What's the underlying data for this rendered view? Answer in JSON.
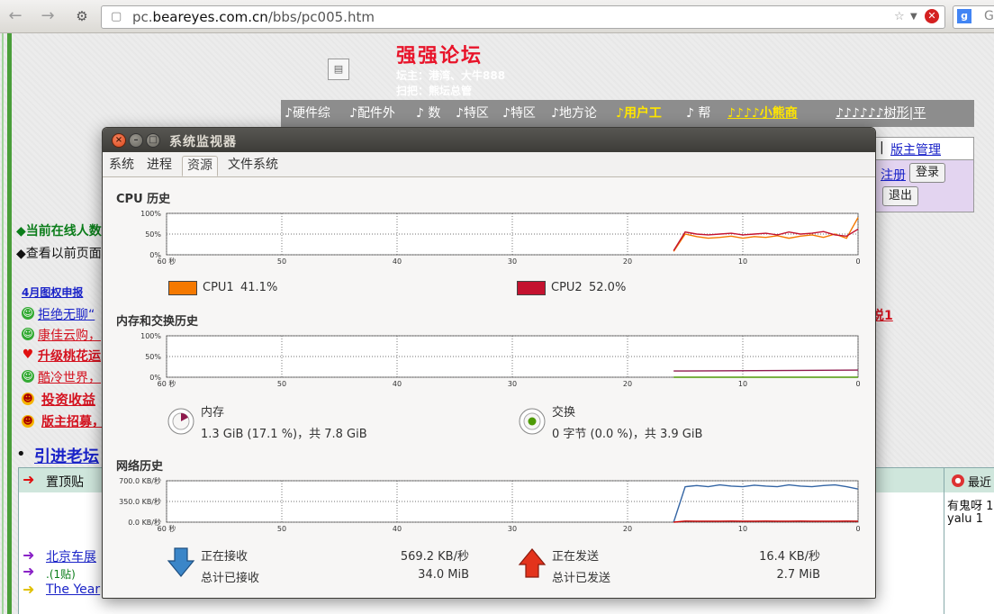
{
  "browser": {
    "url_prefix": "pc.",
    "url_domain": "beareyes.com.cn",
    "url_path": "/bbs/pc005.htm",
    "search_placeholder": "G"
  },
  "forum": {
    "title": "强强论坛",
    "owners": "坛主：港湾、大牛888",
    "sweeper": "扫把：熊坛总管",
    "nav": [
      "硬件综",
      "配件外",
      "数",
      "特区",
      "特区",
      "地方论",
      "用户工",
      "帮",
      "小熊商",
      "树形|平"
    ],
    "admin_link": "版主管理",
    "register_link": "注册",
    "login_button": "登录",
    "logout_button": "退出",
    "online_label": "◆当前在线人数",
    "history_label": "◆查看以前页面",
    "links": [
      {
        "text": "4月图权申报",
        "icon": ""
      },
      {
        "text": "拒绝无聊“",
        "icon": "smile"
      },
      {
        "text": "康佳云购，",
        "icon": "smile"
      },
      {
        "text": "升级桃花运",
        "icon": "heart"
      },
      {
        "text": "酷冷世界，",
        "icon": "smile"
      },
      {
        "text": "投资收益",
        "icon": "grin"
      },
      {
        "text": "版主招募，",
        "icon": "grin"
      }
    ],
    "red_link_right": "说1",
    "intro_title": "引进老坛",
    "pinned_label": "置顶贴",
    "recent_label": "最近",
    "recent_items": [
      "有鬼呀 1",
      "yalu 1"
    ],
    "post_items": [
      "北京车展",
      ".(1贴)",
      "The Year"
    ]
  },
  "window": {
    "title": "系统监视器",
    "tabs": [
      "系统",
      "进程",
      "资源",
      "文件系统"
    ],
    "active_tab": "资源"
  },
  "cpu": {
    "title": "CPU 历史",
    "y_ticks": [
      "100%",
      "50%",
      "0%"
    ],
    "x_ticks": [
      "60 秒",
      "50",
      "40",
      "30",
      "20",
      "10",
      "0"
    ],
    "cpu1_label": "CPU1",
    "cpu1_value": "41.1%",
    "cpu1_color": "#f57900",
    "cpu2_label": "CPU2",
    "cpu2_value": "52.0%",
    "cpu2_color": "#c4122f"
  },
  "memory": {
    "title": "内存和交换历史",
    "y_ticks": [
      "100%",
      "50%",
      "0%"
    ],
    "x_ticks": [
      "60 秒",
      "50",
      "40",
      "30",
      "20",
      "10",
      "0"
    ],
    "mem_label": "内存",
    "mem_value": "1.3 GiB (17.1 %)，共 7.8 GiB",
    "mem_color": "#8e1a4d",
    "swap_label": "交换",
    "swap_value": "0 字节 (0.0 %)，共 3.9 GiB",
    "swap_color": "#4e9a06"
  },
  "network": {
    "title": "网络历史",
    "y_ticks": [
      "700.0 KB/秒",
      "350.0 KB/秒",
      "0.0 KB/秒"
    ],
    "x_ticks": [
      "60 秒",
      "50",
      "40",
      "30",
      "20",
      "10",
      "0"
    ],
    "recv_label": "正在接收",
    "recv_rate": "569.2 KB/秒",
    "recv_total_label": "总计已接收",
    "recv_total": "34.0 MiB",
    "recv_color": "#3465a4",
    "send_label": "正在发送",
    "send_rate": "16.4 KB/秒",
    "send_total_label": "总计已发送",
    "send_total": "2.7 MiB",
    "send_color": "#cc0000"
  },
  "chart_data": [
    {
      "type": "line",
      "title": "CPU 历史",
      "x": [
        16,
        15,
        14,
        13,
        12,
        11,
        10,
        9,
        8,
        7,
        6,
        5,
        4,
        3,
        2,
        1,
        0
      ],
      "xlim": [
        60,
        0
      ],
      "ylim": [
        0,
        100
      ],
      "series": [
        {
          "name": "CPU1",
          "color": "#f57900",
          "values": [
            8,
            50,
            44,
            40,
            42,
            45,
            40,
            44,
            42,
            46,
            40,
            45,
            48,
            42,
            50,
            40,
            90
          ]
        },
        {
          "name": "CPU2",
          "color": "#c4122f",
          "values": [
            10,
            55,
            50,
            48,
            50,
            52,
            48,
            50,
            52,
            48,
            55,
            50,
            52,
            56,
            48,
            45,
            62
          ]
        }
      ]
    },
    {
      "type": "line",
      "title": "内存和交换历史",
      "x": [
        16,
        0
      ],
      "xlim": [
        60,
        0
      ],
      "ylim": [
        0,
        100
      ],
      "series": [
        {
          "name": "内存",
          "color": "#8e1a4d",
          "values": [
            15,
            17.1
          ]
        },
        {
          "name": "交换",
          "color": "#4e9a06",
          "values": [
            0,
            0
          ]
        }
      ]
    },
    {
      "type": "line",
      "title": "网络历史",
      "x": [
        16,
        15,
        14,
        13,
        12,
        11,
        10,
        9,
        8,
        7,
        6,
        5,
        4,
        3,
        2,
        1,
        0
      ],
      "xlim": [
        60,
        0
      ],
      "ylim": [
        0,
        700
      ],
      "series": [
        {
          "name": "正在接收",
          "color": "#3465a4",
          "values": [
            0,
            600,
            620,
            600,
            630,
            610,
            600,
            625,
            610,
            600,
            630,
            610,
            600,
            620,
            630,
            600,
            560
          ]
        },
        {
          "name": "正在发送",
          "color": "#cc0000",
          "values": [
            0,
            18,
            16,
            17,
            16,
            18,
            17,
            16,
            18,
            17,
            16,
            18,
            17,
            16,
            17,
            18,
            16
          ]
        }
      ]
    }
  ]
}
